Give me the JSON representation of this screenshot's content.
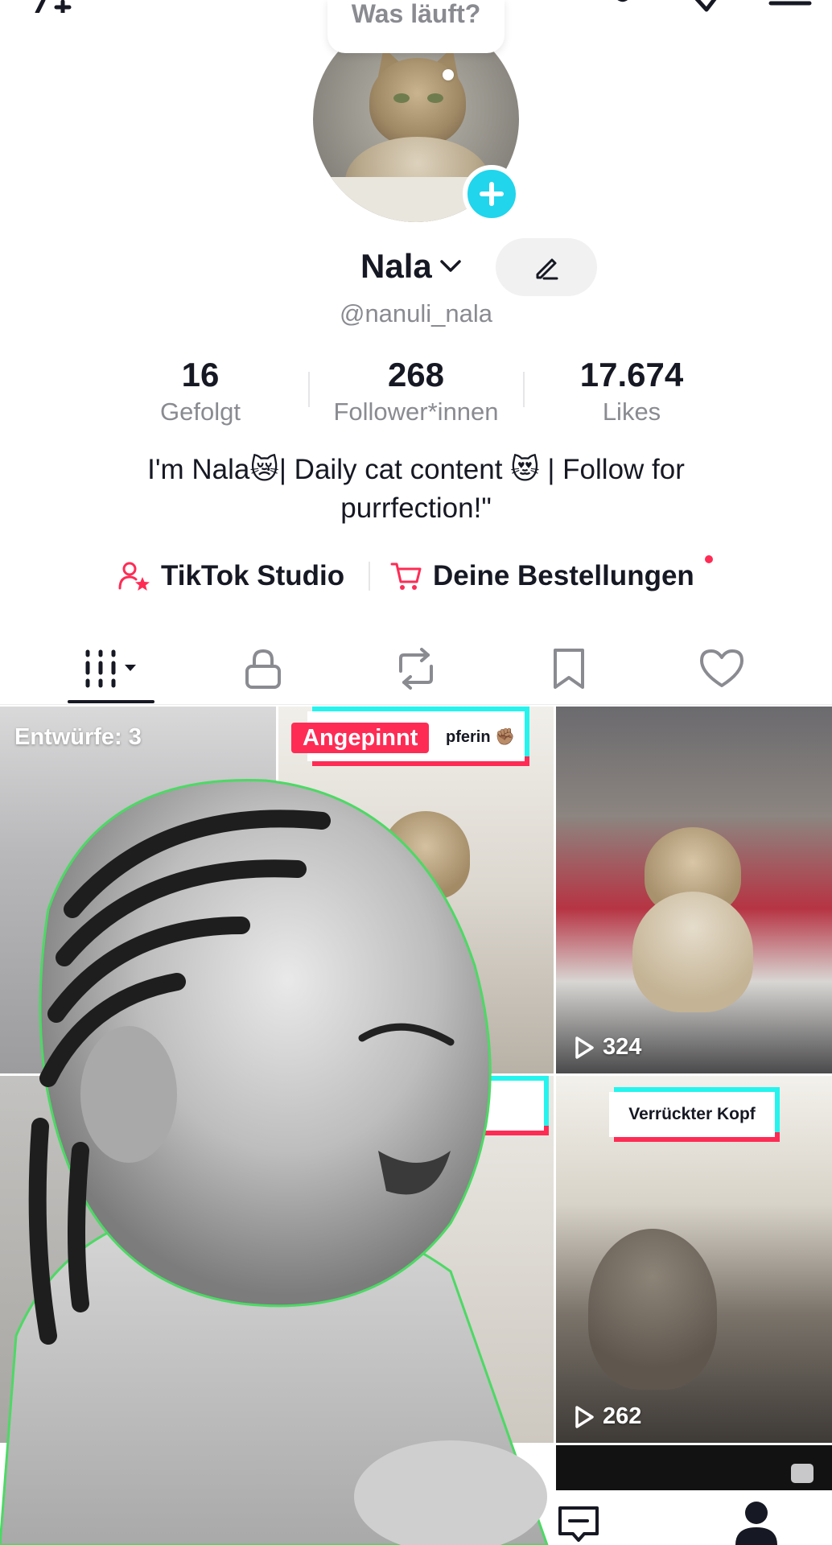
{
  "header": {
    "status_prompt": "Was läuft?",
    "icons": [
      "add-user-icon",
      "activity-icon",
      "share-icon",
      "menu-icon"
    ]
  },
  "profile": {
    "name": "Nala",
    "handle": "@nanuli_nala",
    "avatar_add_icon": "plus-icon"
  },
  "stats": [
    {
      "value": "16",
      "label": "Gefolgt"
    },
    {
      "value": "268",
      "label": "Follower*innen"
    },
    {
      "value": "17.674",
      "label": "Likes"
    }
  ],
  "bio": {
    "line1": "I'm Nala😿| Daily cat content 😻 | Follow for",
    "line2": "purrfection!\""
  },
  "links": {
    "studio": "TikTok Studio",
    "orders": "Deine Bestellungen"
  },
  "tabs": [
    {
      "name": "videos",
      "icon": "grid-icon",
      "active": true
    },
    {
      "name": "private",
      "icon": "lock-icon",
      "active": false
    },
    {
      "name": "reposts",
      "icon": "repost-icon",
      "active": false
    },
    {
      "name": "favorites",
      "icon": "bookmark-icon",
      "active": false
    },
    {
      "name": "liked",
      "icon": "heart-icon",
      "active": false
    }
  ],
  "grid": {
    "drafts_label": "Entwürfe: 3",
    "pinned_label": "Angepinnt",
    "pinned_caption": "pferin ✊🏽",
    "tile3_views": "324",
    "tile6_caption": "Verrückter Kopf",
    "tile6_views": "262"
  },
  "colors": {
    "accent": "#fe2c55",
    "cyan": "#20d5ec",
    "text": "#161823",
    "muted": "#8a8b91"
  }
}
